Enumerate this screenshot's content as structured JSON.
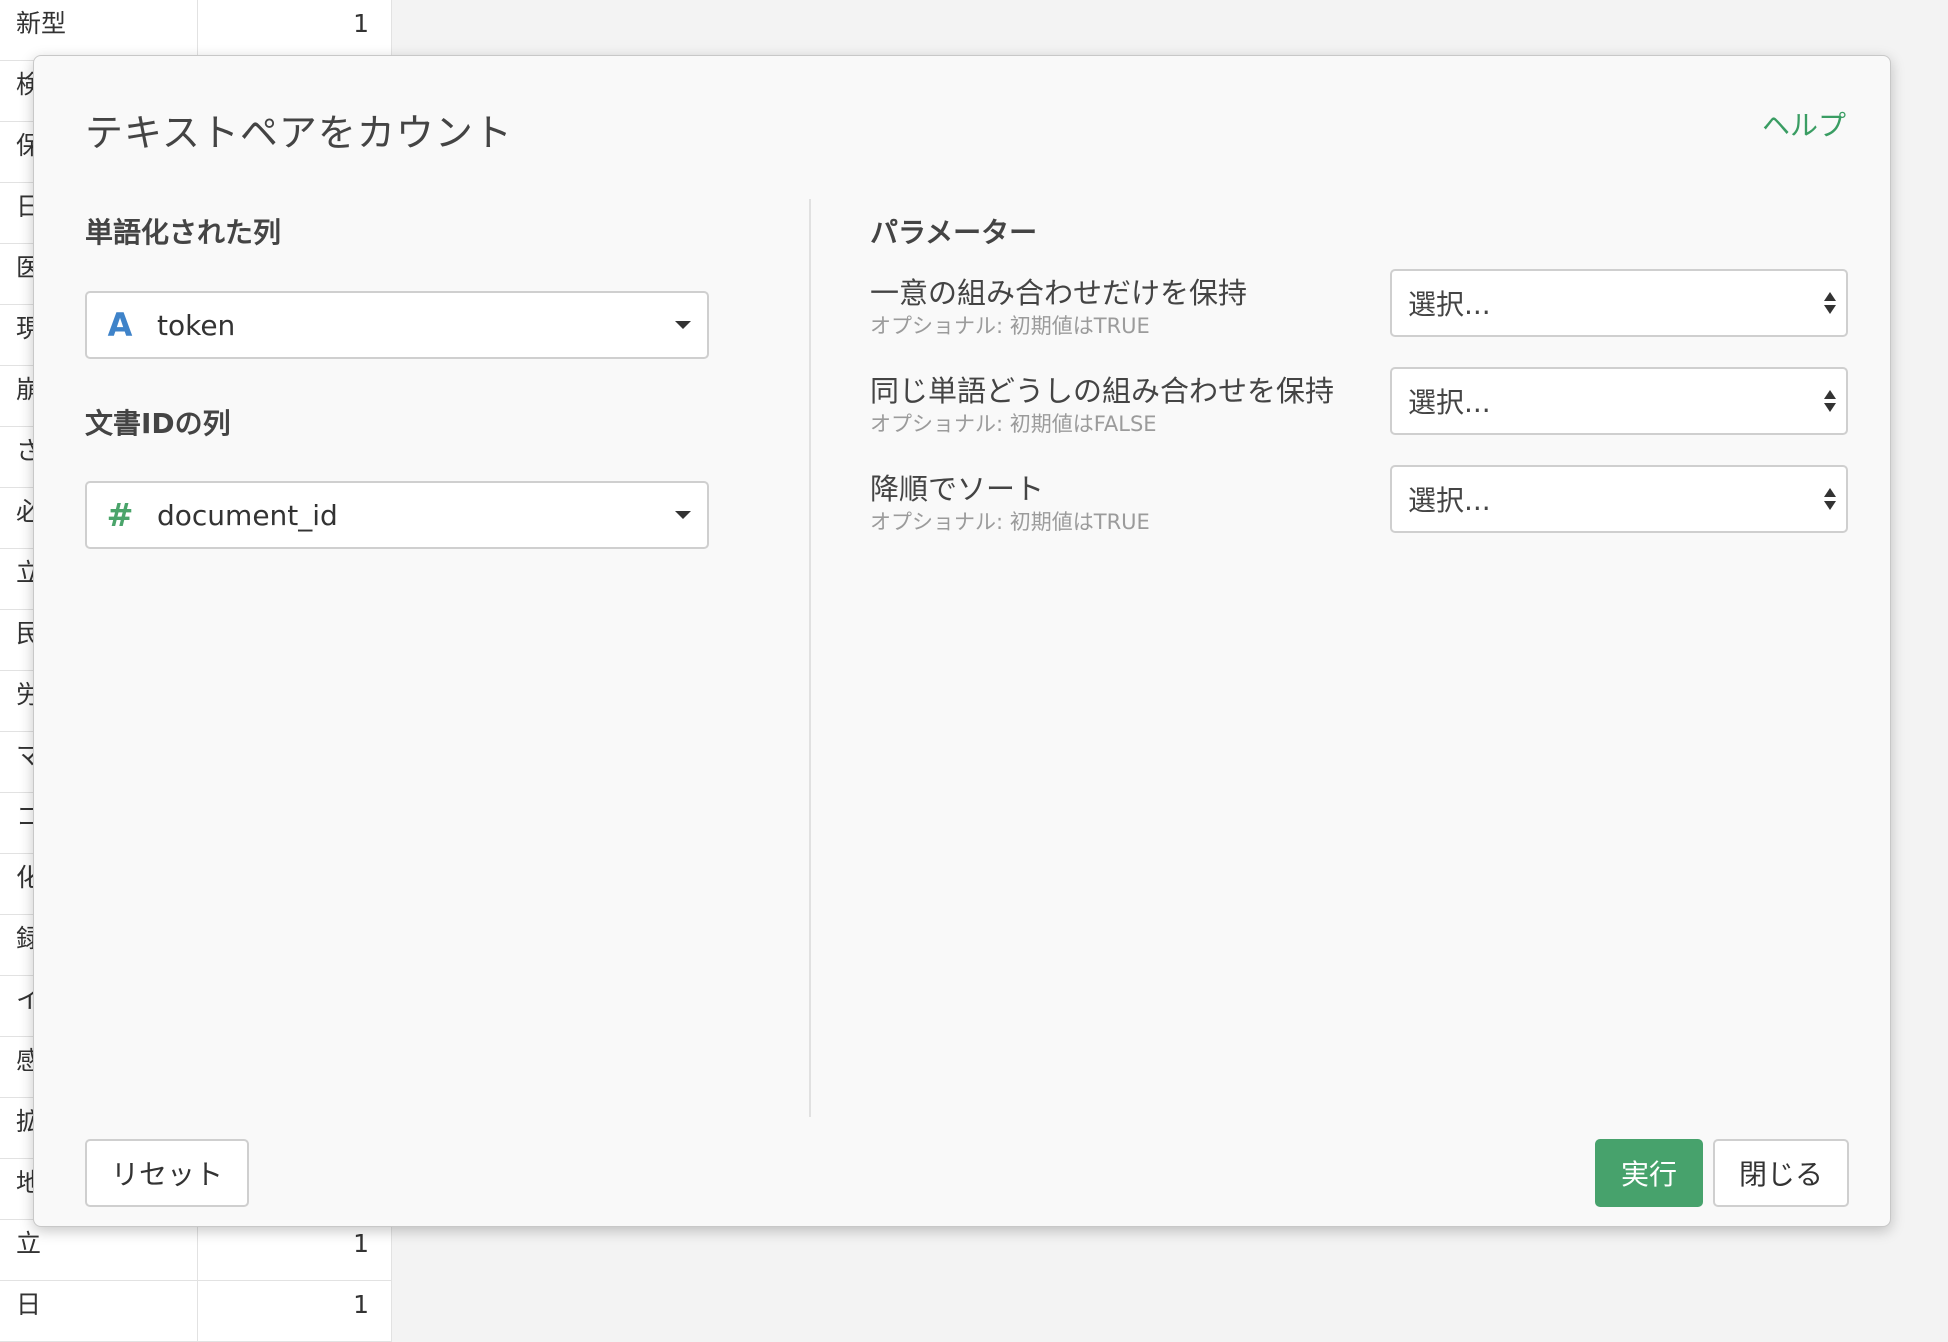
{
  "background_table": {
    "rows": [
      {
        "a": "新型",
        "b": "1"
      },
      {
        "a": "検",
        "b": ""
      },
      {
        "a": "保",
        "b": ""
      },
      {
        "a": "日",
        "b": ""
      },
      {
        "a": "医",
        "b": ""
      },
      {
        "a": "現",
        "b": ""
      },
      {
        "a": "崩",
        "b": ""
      },
      {
        "a": "さ",
        "b": ""
      },
      {
        "a": "必",
        "b": ""
      },
      {
        "a": "立",
        "b": ""
      },
      {
        "a": "民",
        "b": ""
      },
      {
        "a": "労",
        "b": ""
      },
      {
        "a": "マ",
        "b": ""
      },
      {
        "a": "コ",
        "b": ""
      },
      {
        "a": "化",
        "b": ""
      },
      {
        "a": "録",
        "b": ""
      },
      {
        "a": "イ",
        "b": ""
      },
      {
        "a": "感",
        "b": ""
      },
      {
        "a": "拡",
        "b": ""
      },
      {
        "a": "地",
        "b": ""
      },
      {
        "a": "立",
        "b": "1"
      },
      {
        "a": "日",
        "b": "1"
      }
    ]
  },
  "dialog": {
    "title": "テキストペアをカウント",
    "help": "ヘルプ",
    "left": {
      "tokenized_label": "単語化された列",
      "tokenized_value": "token",
      "tokenized_type_icon": "A",
      "docid_label": "文書IDの列",
      "docid_value": "document_id",
      "docid_type_icon": "#"
    },
    "parameters": {
      "heading": "パラメーター",
      "items": [
        {
          "name": "一意の組み合わせだけを保持",
          "sub": "オプショナル: 初期値はTRUE",
          "placeholder": "選択..."
        },
        {
          "name": "同じ単語どうしの組み合わせを保持",
          "sub": "オプショナル: 初期値はFALSE",
          "placeholder": "選択..."
        },
        {
          "name": "降順でソート",
          "sub": "オプショナル: 初期値はTRUE",
          "placeholder": "選択..."
        }
      ]
    },
    "footer": {
      "reset": "リセット",
      "run": "実行",
      "close": "閉じる"
    }
  },
  "colors": {
    "accent_green": "#47a26c",
    "link_green": "#3a9d63",
    "type_a_blue": "#3f83c9"
  }
}
